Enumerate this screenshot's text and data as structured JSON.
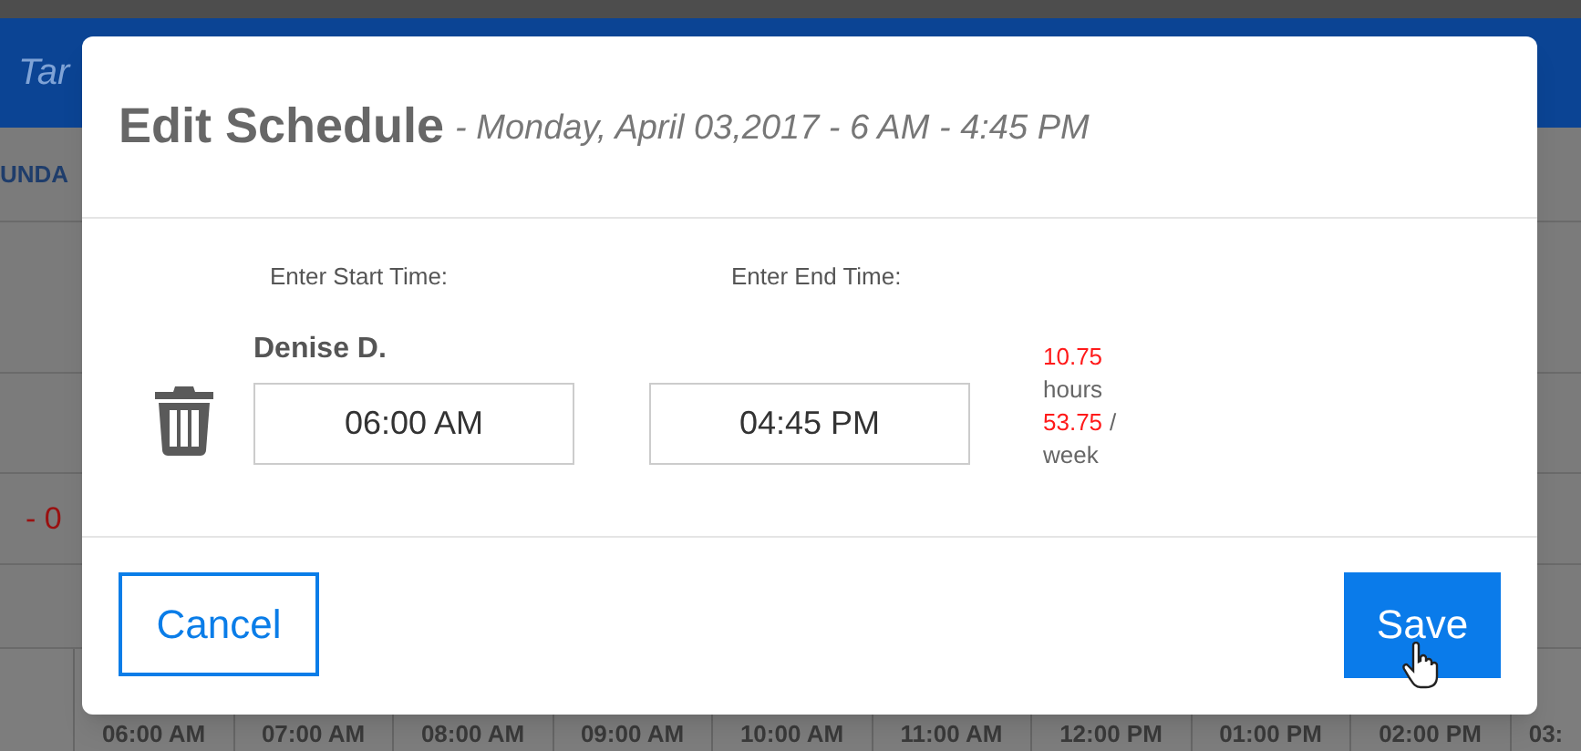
{
  "background": {
    "banner_text": "Tar",
    "column_header": "UNDA",
    "row_value": "- 0",
    "time_slots": [
      "06:00 AM",
      "07:00 AM",
      "08:00 AM",
      "09:00 AM",
      "10:00 AM",
      "11:00 AM",
      "12:00 PM",
      "01:00 PM",
      "02:00 PM",
      "03:"
    ]
  },
  "dialog": {
    "title": "Edit Schedule",
    "subtitle": "- Monday, April 03,2017 - 6 AM - 4:45 PM",
    "start_label": "Enter Start Time:",
    "end_label": "Enter End Time:",
    "employee": "Denise D.",
    "start_time": "06:00 AM",
    "end_time": "04:45 PM",
    "daily_hours": "10.75",
    "daily_unit": "hours",
    "weekly_hours": "53.75",
    "weekly_separator": "/",
    "weekly_unit": "week",
    "buttons": [
      {
        "kind": "secondary",
        "label": "Cancel"
      },
      {
        "kind": "primary",
        "label": "Save"
      }
    ]
  }
}
